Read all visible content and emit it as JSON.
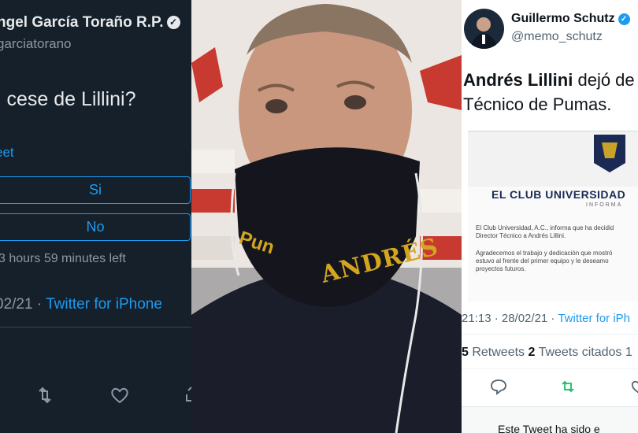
{
  "left_tweet": {
    "author_name": "ngel García Toraño R.P.",
    "handle": "garciatorano",
    "question": "l cese de Lillini?",
    "vote_link": "eet",
    "options": [
      "Si",
      "No"
    ],
    "time_left": "3 hours 59 minutes left",
    "date": "02/21 · ",
    "client": "Twitter for iPhone",
    "icons": [
      "retweet-icon",
      "heart-icon",
      "share-icon"
    ]
  },
  "video_frame": {
    "mask_text": "ANDRÉS",
    "mask_text_left": "Pun"
  },
  "right_tweet": {
    "author_name": "Guillermo Schutz",
    "handle": "@memo_schutz",
    "text_bold": "Andrés Lillini",
    "text_rest": " dejó de se",
    "text_line2": "Técnico de Pumas.",
    "card": {
      "title": "EL CLUB UNIVERSIDAD",
      "subtitle": "INFORMA",
      "p1_line1": "El Club Universidad, A.C., informa que ha decidid",
      "p1_line2": "Director Técnico a Andrés Lillini.",
      "p2_line1": "Agradecemos el trabajo y dedicación que mostró",
      "p2_line2": "estuvo al frente del primer equipo y le deseamo",
      "p2_line3": "proyectos futuros."
    },
    "date": "21:13 · 28/02/21 · ",
    "client": "Twitter for iPh",
    "retweets_count": "5",
    "retweets_label": " Retweets  ",
    "quotes_count": "2",
    "quotes_label": " Tweets citados  1",
    "footer": "Este Tweet ha sido e",
    "icons": [
      "reply-icon",
      "retweet-icon",
      "heart-icon"
    ]
  },
  "colors": {
    "dark_bg": "#15202b",
    "twitter_blue": "#1d9bf0",
    "retweet_green": "#17bf63"
  }
}
